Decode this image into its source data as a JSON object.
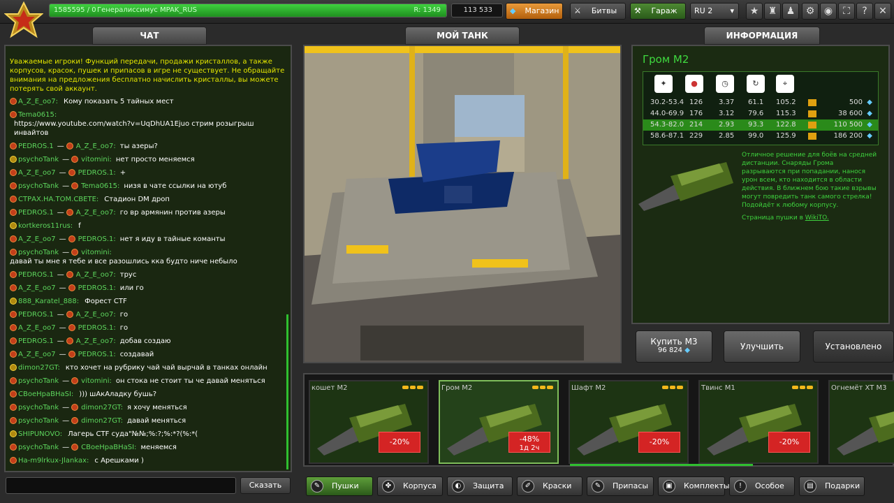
{
  "header": {
    "rank_text": "1585595 / 0",
    "player": "Генералиссимус MPAK_RUS",
    "rating": "R: 1349",
    "crystals": "113 533",
    "shop": "Магазин",
    "battles": "Битвы",
    "garage": "Гараж",
    "server": "RU 2"
  },
  "tabs": {
    "chat": "ЧАТ",
    "tank": "МОЙ ТАНК",
    "info": "ИНФОРМАЦИЯ"
  },
  "chat": {
    "warning": "Уважаемые игроки! Функций передачи, продажи кристаллов, а также корпусов, красок, пушек и припасов в игре не существует. Не обращайте внимания на предложения бесплатно начислить кристаллы, вы можете потерять свой аккаунт.",
    "messages": [
      {
        "from": "A_Z_E_oo7:",
        "to": "",
        "text": "Кому показать 5 тайных мест"
      },
      {
        "from": "Tema0615:",
        "to": "",
        "text": "https://www.youtube.com/watch?v=UqDhUA1Ejuo стрим розыгрыш инвайтов"
      },
      {
        "from": "PEDROS.1",
        "to": "A_Z_E_oo7:",
        "text": "ты азеры?"
      },
      {
        "from": "psychoTank",
        "to": "vitomini:",
        "text": "нет просто меняемся"
      },
      {
        "from": "A_Z_E_oo7",
        "to": "PEDROS.1:",
        "text": "+"
      },
      {
        "from": "psychoTank",
        "to": "Tema0615:",
        "text": "низя в чате ссылки на ютуб"
      },
      {
        "from": "СТРАХ.НА.ТОМ.СВЕТЕ:",
        "to": "",
        "text": "Стадион DM дроп"
      },
      {
        "from": "PEDROS.1",
        "to": "A_Z_E_oo7:",
        "text": "го вр армянин против азеры"
      },
      {
        "from": "kortkeros11rus:",
        "to": "",
        "text": "f"
      },
      {
        "from": "A_Z_E_oo7",
        "to": "PEDROS.1:",
        "text": "нет я иду в тайные команты"
      },
      {
        "from": "psychoTank",
        "to": "vitomini:",
        "text": "давай ты мне я тебе и все разошлись кка будто ниче небыло"
      },
      {
        "from": "PEDROS.1",
        "to": "A_Z_E_oo7:",
        "text": "трус"
      },
      {
        "from": "A_Z_E_oo7",
        "to": "PEDROS.1:",
        "text": "или го"
      },
      {
        "from": "888_Karatel_888:",
        "to": "",
        "text": "Форест CTF"
      },
      {
        "from": "PEDROS.1",
        "to": "A_Z_E_oo7:",
        "text": "го"
      },
      {
        "from": "A_Z_E_oo7",
        "to": "PEDROS.1:",
        "text": "го"
      },
      {
        "from": "PEDROS.1",
        "to": "A_Z_E_oo7:",
        "text": "добав создаю"
      },
      {
        "from": "A_Z_E_oo7",
        "to": "PEDROS.1:",
        "text": "создавай"
      },
      {
        "from": "dimon27GT:",
        "to": "",
        "text": "кто хочет на рубрику чай чай вырчай в танках онлайн"
      },
      {
        "from": "psychoTank",
        "to": "vitomini:",
        "text": "он стока не стоит ты че давай меняться"
      },
      {
        "from": "CBoeHpaBHaSI:",
        "to": "",
        "text": "))) шАкАладку бушь?"
      },
      {
        "from": "psychoTank",
        "to": "dimon27GT:",
        "text": "я хочу меняться"
      },
      {
        "from": "psychoTank",
        "to": "dimon27GT:",
        "text": "давай меняться"
      },
      {
        "from": "SHIPUNOVO:",
        "to": "",
        "text": "Лагерь CTF суда\"№№;%:?;%:*?(%:*("
      },
      {
        "from": "psychoTank",
        "to": "CBoeHpaBHaSI:",
        "text": "меняемся"
      },
      {
        "from": "Ha-m9lrkux-Jlankax:",
        "to": "",
        "text": "с Арешками )"
      }
    ],
    "send": "Сказать"
  },
  "info": {
    "title": "Гром M2",
    "rows": [
      [
        "30.2-53.4",
        "126",
        "3.37",
        "61.1",
        "105.2",
        "500"
      ],
      [
        "44.0-69.9",
        "176",
        "3.12",
        "79.6",
        "115.3",
        "38 600"
      ],
      [
        "54.3-82.0",
        "214",
        "2.93",
        "93.3",
        "122.8",
        "110 500"
      ],
      [
        "58.6-87.1",
        "229",
        "2.85",
        "99.0",
        "125.9",
        "186 200"
      ]
    ],
    "desc": "Отличное решение для боёв на средней дистанции. Снаряды Грома разрываются при попадании, нанося урон всем, кто находится в области действия. В ближнем бою такие взрывы могут повредить танк самого стрелка! Подойдёт к любому корпусу.",
    "wiki_prefix": "Страница пушки в",
    "wiki": "WikiTO.",
    "buy": "Купить M3",
    "buy_price": "96 824",
    "upgrade": "Улучшить",
    "installed": "Установлено"
  },
  "cards": [
    {
      "name": "кошет M2",
      "disc": "-20%",
      "sub": ""
    },
    {
      "name": "Гром M2",
      "disc": "-48%",
      "sub": "1д 2ч"
    },
    {
      "name": "Шафт M2",
      "disc": "-20%",
      "sub": ""
    },
    {
      "name": "Твинс M1",
      "disc": "-20%",
      "sub": ""
    },
    {
      "name": "Огнемёт XT M3",
      "disc": "",
      "sub": ""
    }
  ],
  "categories": [
    "Пушки",
    "Корпуса",
    "Защита",
    "Краски",
    "Припасы",
    "Комплекты",
    "Особое",
    "Подарки"
  ]
}
